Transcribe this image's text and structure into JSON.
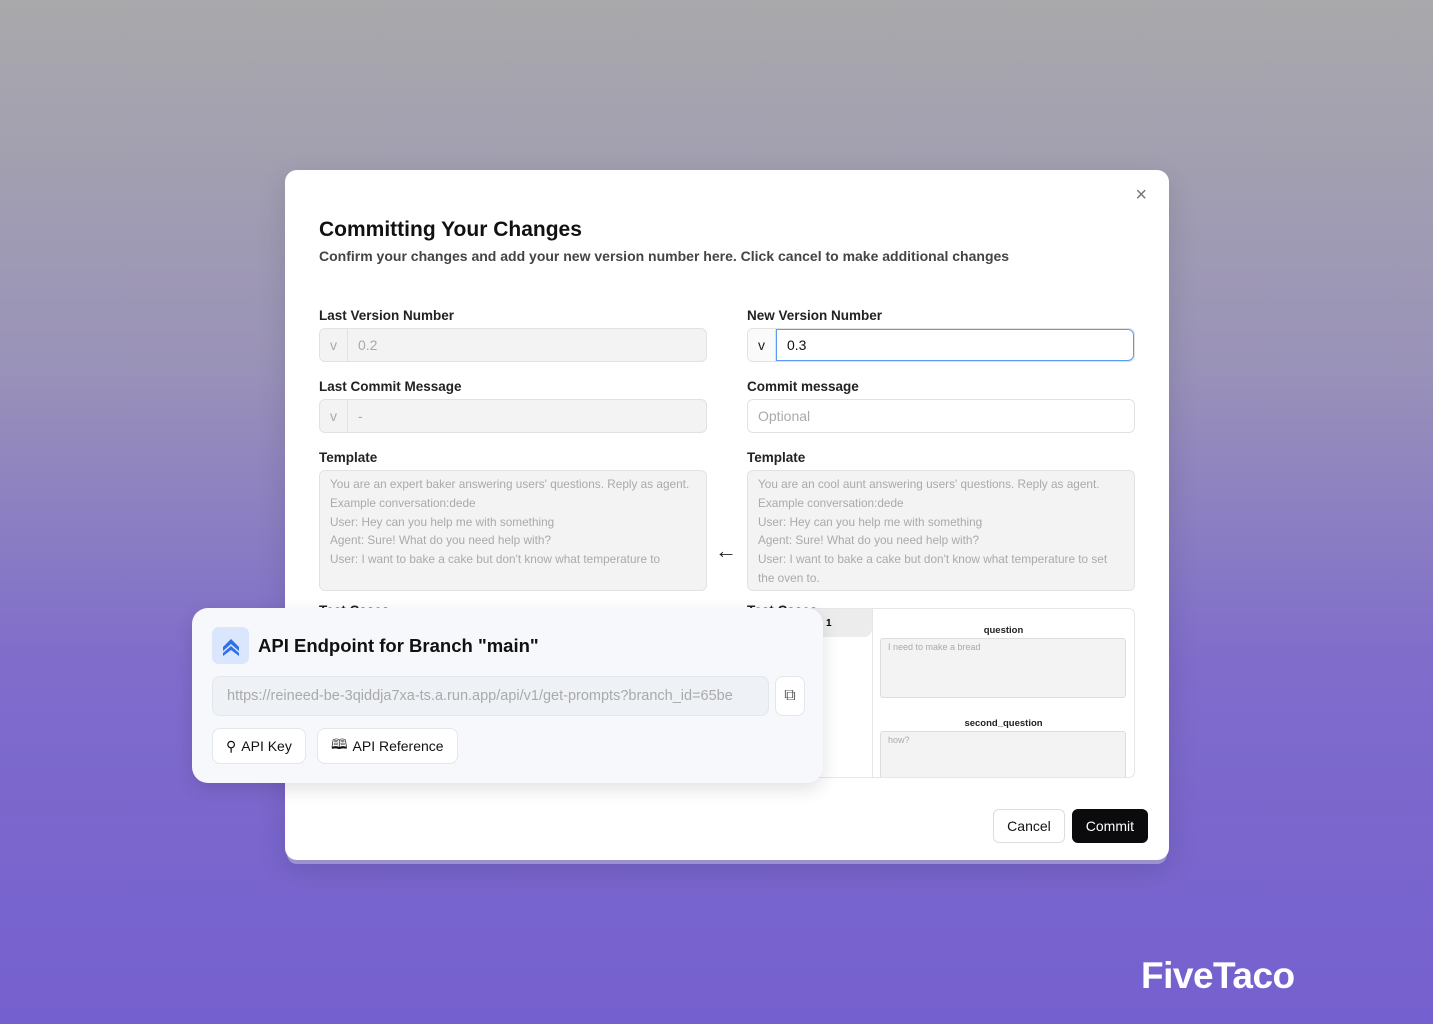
{
  "modal": {
    "title": "Committing Your Changes",
    "subtitle": "Confirm your changes and add your new version number here. Click cancel to make additional changes",
    "close": "×",
    "left": {
      "version_label": "Last Version Number",
      "version_prefix": "v",
      "version_value": "0.2",
      "commit_label": "Last Commit Message",
      "commit_prefix": "v",
      "commit_value": "-",
      "template_label": "Template",
      "template_lines": [
        "You are an expert baker answering users' questions. Reply as agent.",
        "Example conversation:dede",
        "User: Hey can you help me with something",
        "Agent: Sure! What do you need help with?",
        "User: I want to bake a cake but don't know what temperature to"
      ],
      "testcases_label": "Test Cases"
    },
    "right": {
      "version_label": "New Version Number",
      "version_prefix": "v",
      "version_value": "0.3",
      "commit_label": "Commit message",
      "commit_placeholder": "Optional",
      "template_label": "Template",
      "template_lines": [
        "You are an cool aunt answering users' questions. Reply as agent.",
        "Example conversation:dede",
        "User: Hey can you help me with something",
        "Agent: Sure! What do you need help with?",
        "User: I want to bake a cake but don't know what temperature to set the oven to."
      ],
      "testcases_label": "Test Cases",
      "testcase": {
        "tab": "1",
        "fields": [
          {
            "name": "question",
            "value": "I need to make a bread"
          },
          {
            "name": "second_question",
            "value": "how?"
          }
        ]
      }
    },
    "cancel": "Cancel",
    "commit": "Commit"
  },
  "api_card": {
    "title": "API Endpoint for Branch \"main\"",
    "url": "https://reineed-be-3qiddja7xa-ts.a.run.app/api/v1/get-prompts?branch_id=65be",
    "api_key": "API Key",
    "api_reference": "API Reference",
    "accent": "#2f6fe8"
  },
  "brand": "FiveTaco"
}
